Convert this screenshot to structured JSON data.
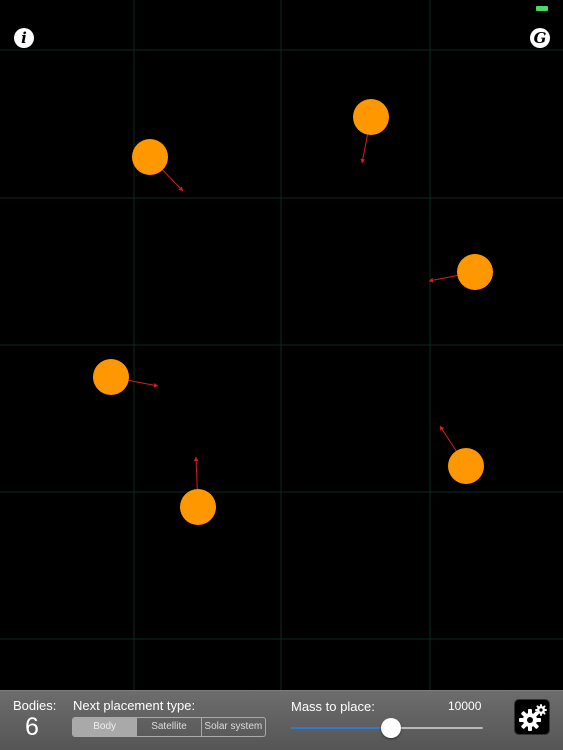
{
  "canvas": {
    "background": "#000000",
    "grid_color": "#0b2a20",
    "body_color": "#ff9800",
    "vector_color": "#d32020"
  },
  "top_controls": {
    "info_icon": "info-icon",
    "info_glyph": "i",
    "gravity_icon": "gravity-icon",
    "gravity_glyph": "G",
    "battery_color": "#4cd964"
  },
  "bottom_bar": {
    "bodies_label": "Bodies:",
    "bodies_count": "6",
    "placement_label": "Next placement type:",
    "placement_options": [
      "Body",
      "Satellite",
      "Solar system"
    ],
    "placement_selected": "Body",
    "mass_label": "Mass to place:",
    "mass_value": "10000",
    "mass_slider_fraction": 0.52,
    "settings_icon": "gear-icon"
  }
}
